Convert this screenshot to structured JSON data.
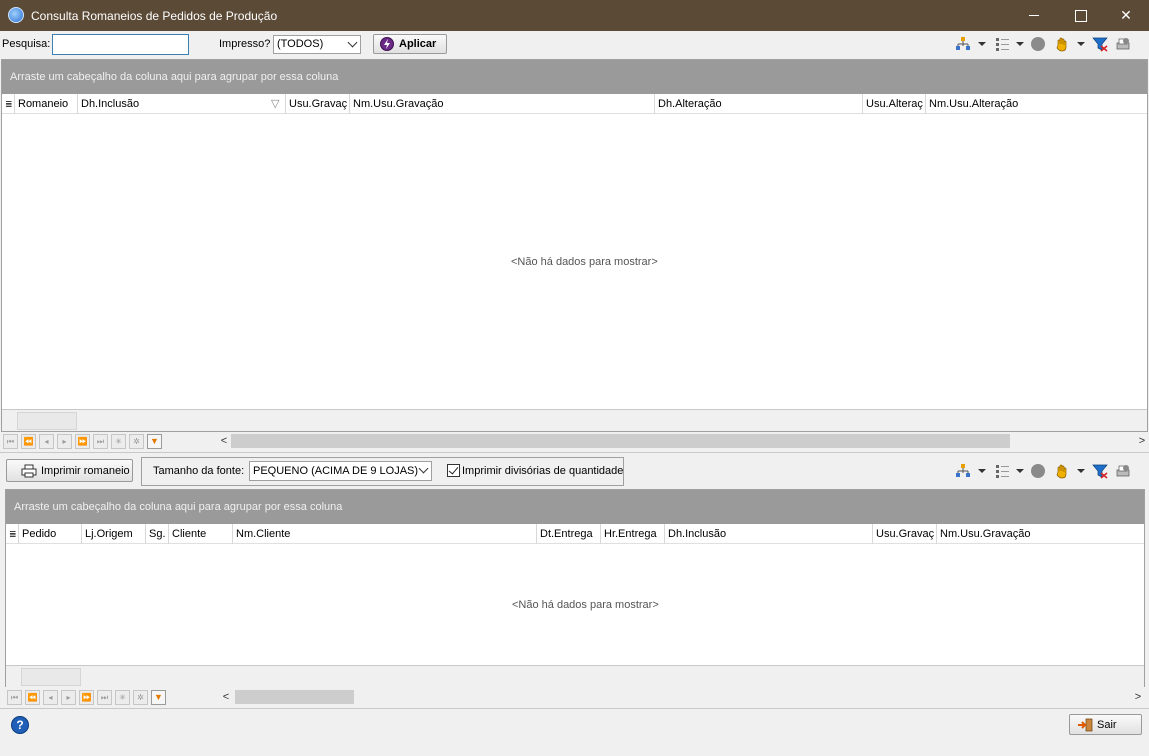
{
  "window": {
    "title": "Consulta Romaneios de Pedidos de Produção"
  },
  "colors": {
    "titlebar": "#5b4a36",
    "group_panel": "#9a9a9a",
    "accent_input": "#3c7fb1",
    "filter_orange": "#e27a00"
  },
  "toolbar": {
    "search_label": "Pesquisa:",
    "search_value": "",
    "printed_label": "Impresso?",
    "printed_value": "(TODOS)",
    "apply_label": "Aplicar",
    "icons": [
      "group-tree-icon",
      "column-chooser-icon",
      "layout-icon",
      "hand-icon",
      "filter-icon",
      "printer-settings-icon"
    ]
  },
  "grid1": {
    "group_hint": "Arraste um cabeçalho da coluna aqui para agrupar por essa coluna",
    "columns": [
      "Romaneio",
      "Dh.Inclusão",
      "Usu.Gravaç",
      "Nm.Usu.Gravação",
      "Dh.Alteração",
      "Usu.Alteraç",
      "Nm.Usu.Alteração"
    ],
    "empty_text": "<Não há dados para mostrar>"
  },
  "middle": {
    "print_button": "Imprimir romaneio",
    "font_size_label": "Tamanho da fonte:",
    "font_size_value": "PEQUENO (ACIMA DE 9 LOJAS)",
    "print_dividers_label": "Imprimir divisórias de quantidade",
    "print_dividers_checked": true
  },
  "grid2": {
    "group_hint": "Arraste um cabeçalho da coluna aqui para agrupar por essa coluna",
    "columns": [
      "Pedido",
      "Lj.Origem",
      "Sg.",
      "Cliente",
      "Nm.Cliente",
      "Dt.Entrega",
      "Hr.Entrega",
      "Dh.Inclusão",
      "Usu.Gravaç",
      "Nm.Usu.Gravação"
    ],
    "empty_text": "<Não há dados para mostrar>"
  },
  "bottom": {
    "exit_label": "Sair"
  }
}
